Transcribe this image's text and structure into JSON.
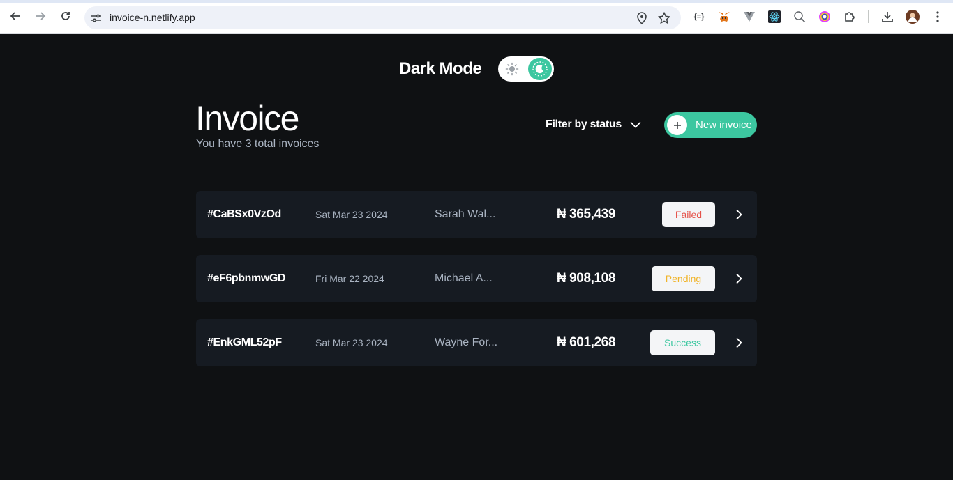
{
  "browser": {
    "url": "invoice-n.netlify.app",
    "extensions": [
      "json-viewer-icon",
      "metamask-icon",
      "vue-devtools-icon",
      "react-devtools-icon",
      "zoom-icon",
      "color-picker-icon",
      "extensions-puzzle-icon"
    ],
    "json_ext_label": "{=}"
  },
  "header": {
    "dark_mode_label": "Dark Mode",
    "title": "Invoice",
    "subtitle": "You have 3 total invoices",
    "filter_label": "Filter by status",
    "new_invoice_label": "New invoice"
  },
  "invoices": [
    {
      "id": "#CaBSx0VzOd",
      "date": "Sat Mar 23 2024",
      "client": "Sarah Wal...",
      "amount": "₦ 365,439",
      "status": "Failed"
    },
    {
      "id": "#eF6pbnmwGD",
      "date": "Fri Mar 22 2024",
      "client": "Michael A...",
      "amount": "₦ 908,108",
      "status": "Pending"
    },
    {
      "id": "#EnkGML52pF",
      "date": "Sat Mar 23 2024",
      "client": "Wayne For...",
      "amount": "₦ 601,268",
      "status": "Success"
    }
  ],
  "colors": {
    "accent": "#3cc7a0",
    "failed": "#e5534b",
    "pending": "#f0b429",
    "success": "#3cc7a0",
    "page_bg": "#0f1113",
    "card_bg": "#161b22"
  }
}
